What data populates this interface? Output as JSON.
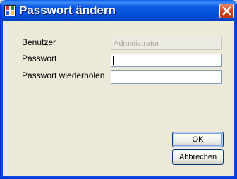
{
  "window": {
    "title": "Passwort ändern"
  },
  "icons": {
    "app": "application-icon",
    "close": "close-icon"
  },
  "colors": {
    "titlebar": "#0654dd",
    "close": "#d1401b",
    "dialog_bg": "#ece9d8"
  },
  "form": {
    "user_label": "Benutzer",
    "user_value": "Administrator",
    "password_label": "Passwort",
    "password_value": "",
    "repeat_label": "Passwort wiederholen",
    "repeat_value": ""
  },
  "buttons": {
    "ok": "OK",
    "cancel": "Abbrechen"
  }
}
